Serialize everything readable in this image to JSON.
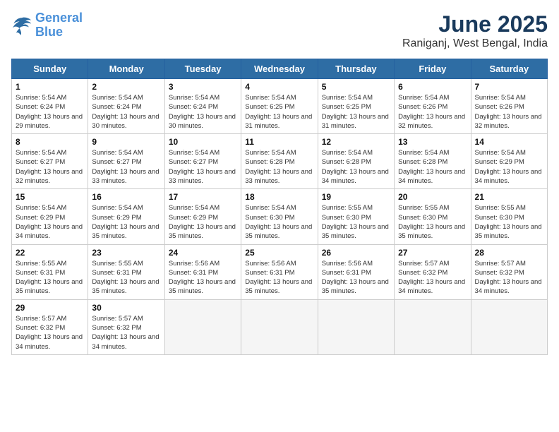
{
  "logo": {
    "line1": "General",
    "line2": "Blue"
  },
  "title": "June 2025",
  "location": "Raniganj, West Bengal, India",
  "weekdays": [
    "Sunday",
    "Monday",
    "Tuesday",
    "Wednesday",
    "Thursday",
    "Friday",
    "Saturday"
  ],
  "weeks": [
    [
      {
        "day": 1,
        "sunrise": "5:54 AM",
        "sunset": "6:24 PM",
        "daylight": "13 hours and 29 minutes."
      },
      {
        "day": 2,
        "sunrise": "5:54 AM",
        "sunset": "6:24 PM",
        "daylight": "13 hours and 30 minutes."
      },
      {
        "day": 3,
        "sunrise": "5:54 AM",
        "sunset": "6:24 PM",
        "daylight": "13 hours and 30 minutes."
      },
      {
        "day": 4,
        "sunrise": "5:54 AM",
        "sunset": "6:25 PM",
        "daylight": "13 hours and 31 minutes."
      },
      {
        "day": 5,
        "sunrise": "5:54 AM",
        "sunset": "6:25 PM",
        "daylight": "13 hours and 31 minutes."
      },
      {
        "day": 6,
        "sunrise": "5:54 AM",
        "sunset": "6:26 PM",
        "daylight": "13 hours and 32 minutes."
      },
      {
        "day": 7,
        "sunrise": "5:54 AM",
        "sunset": "6:26 PM",
        "daylight": "13 hours and 32 minutes."
      }
    ],
    [
      {
        "day": 8,
        "sunrise": "5:54 AM",
        "sunset": "6:27 PM",
        "daylight": "13 hours and 32 minutes."
      },
      {
        "day": 9,
        "sunrise": "5:54 AM",
        "sunset": "6:27 PM",
        "daylight": "13 hours and 33 minutes."
      },
      {
        "day": 10,
        "sunrise": "5:54 AM",
        "sunset": "6:27 PM",
        "daylight": "13 hours and 33 minutes."
      },
      {
        "day": 11,
        "sunrise": "5:54 AM",
        "sunset": "6:28 PM",
        "daylight": "13 hours and 33 minutes."
      },
      {
        "day": 12,
        "sunrise": "5:54 AM",
        "sunset": "6:28 PM",
        "daylight": "13 hours and 34 minutes."
      },
      {
        "day": 13,
        "sunrise": "5:54 AM",
        "sunset": "6:28 PM",
        "daylight": "13 hours and 34 minutes."
      },
      {
        "day": 14,
        "sunrise": "5:54 AM",
        "sunset": "6:29 PM",
        "daylight": "13 hours and 34 minutes."
      }
    ],
    [
      {
        "day": 15,
        "sunrise": "5:54 AM",
        "sunset": "6:29 PM",
        "daylight": "13 hours and 34 minutes."
      },
      {
        "day": 16,
        "sunrise": "5:54 AM",
        "sunset": "6:29 PM",
        "daylight": "13 hours and 35 minutes."
      },
      {
        "day": 17,
        "sunrise": "5:54 AM",
        "sunset": "6:29 PM",
        "daylight": "13 hours and 35 minutes."
      },
      {
        "day": 18,
        "sunrise": "5:54 AM",
        "sunset": "6:30 PM",
        "daylight": "13 hours and 35 minutes."
      },
      {
        "day": 19,
        "sunrise": "5:55 AM",
        "sunset": "6:30 PM",
        "daylight": "13 hours and 35 minutes."
      },
      {
        "day": 20,
        "sunrise": "5:55 AM",
        "sunset": "6:30 PM",
        "daylight": "13 hours and 35 minutes."
      },
      {
        "day": 21,
        "sunrise": "5:55 AM",
        "sunset": "6:30 PM",
        "daylight": "13 hours and 35 minutes."
      }
    ],
    [
      {
        "day": 22,
        "sunrise": "5:55 AM",
        "sunset": "6:31 PM",
        "daylight": "13 hours and 35 minutes."
      },
      {
        "day": 23,
        "sunrise": "5:55 AM",
        "sunset": "6:31 PM",
        "daylight": "13 hours and 35 minutes."
      },
      {
        "day": 24,
        "sunrise": "5:56 AM",
        "sunset": "6:31 PM",
        "daylight": "13 hours and 35 minutes."
      },
      {
        "day": 25,
        "sunrise": "5:56 AM",
        "sunset": "6:31 PM",
        "daylight": "13 hours and 35 minutes."
      },
      {
        "day": 26,
        "sunrise": "5:56 AM",
        "sunset": "6:31 PM",
        "daylight": "13 hours and 35 minutes."
      },
      {
        "day": 27,
        "sunrise": "5:57 AM",
        "sunset": "6:32 PM",
        "daylight": "13 hours and 34 minutes."
      },
      {
        "day": 28,
        "sunrise": "5:57 AM",
        "sunset": "6:32 PM",
        "daylight": "13 hours and 34 minutes."
      }
    ],
    [
      {
        "day": 29,
        "sunrise": "5:57 AM",
        "sunset": "6:32 PM",
        "daylight": "13 hours and 34 minutes."
      },
      {
        "day": 30,
        "sunrise": "5:57 AM",
        "sunset": "6:32 PM",
        "daylight": "13 hours and 34 minutes."
      },
      null,
      null,
      null,
      null,
      null
    ]
  ]
}
